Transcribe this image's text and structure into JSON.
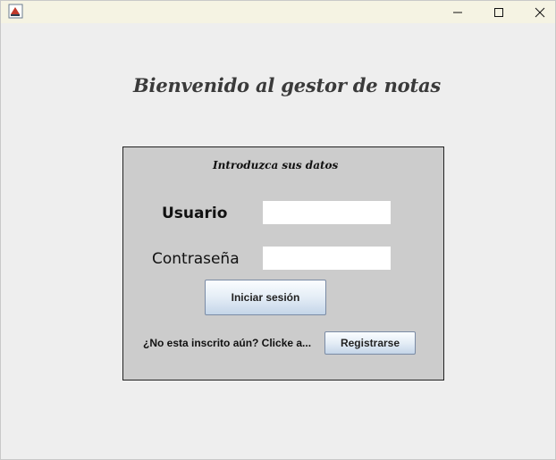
{
  "window": {
    "title": "",
    "controls": [
      "minimize-icon",
      "maximize-icon",
      "close-icon"
    ]
  },
  "main": {
    "heading": "Bienvenido al gestor de notas"
  },
  "login_panel": {
    "title": "Introduzca sus datos",
    "username_label": "Usuario",
    "username_value": "",
    "password_label": "Contraseña",
    "password_value": "",
    "login_button": "Iniciar sesión",
    "register_prompt": "¿No esta inscrito aún? Clicke a...",
    "register_button": "Registrarse"
  },
  "colors": {
    "window_bg": "#eeeeee",
    "titlebar_bg": "#f5f3e3",
    "panel_bg": "#cccccc",
    "panel_border": "#222222",
    "button_border": "#7a8ba5"
  }
}
